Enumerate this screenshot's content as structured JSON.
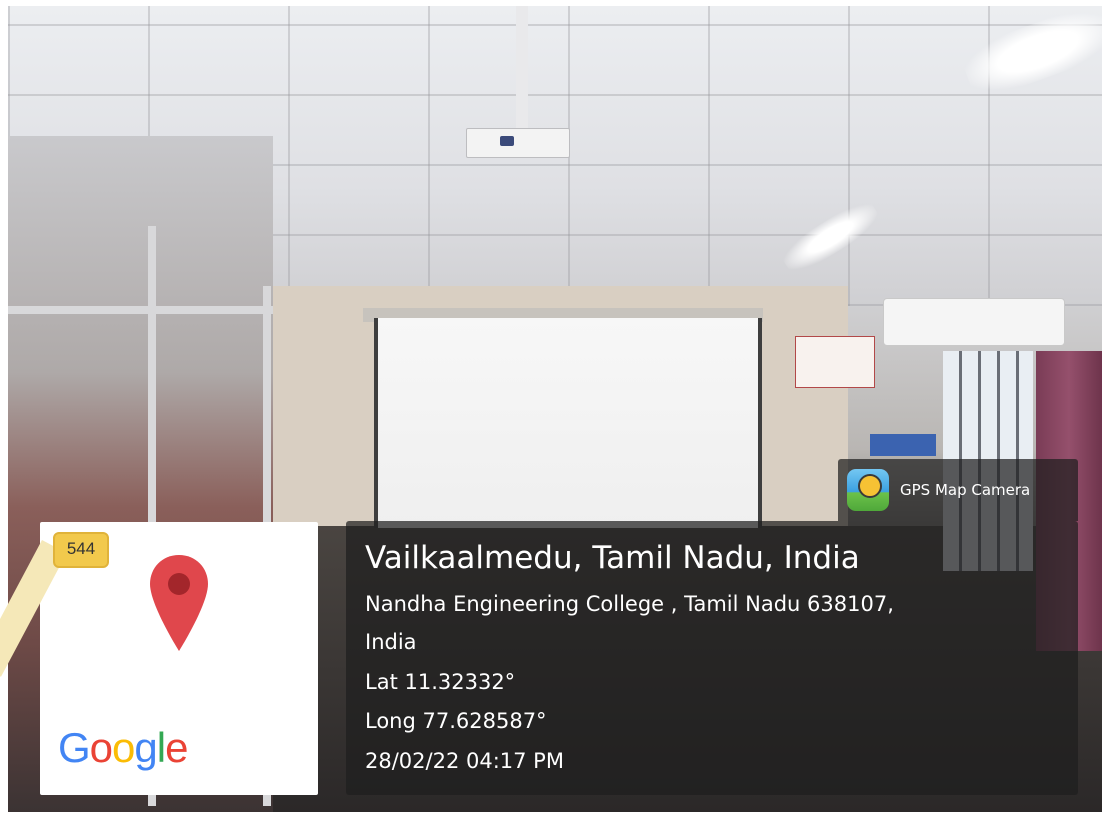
{
  "map": {
    "route_number": "544",
    "logo": "Google",
    "pin_icon": "map-pin-icon",
    "pin_color": "#e0474c"
  },
  "app": {
    "name": "GPS Map Camera",
    "icon": "gps-map-camera-icon"
  },
  "location": {
    "title": "Vailkaalmedu, Tamil Nadu, India",
    "address_line1": "Nandha Engineering College , Tamil Nadu 638107,",
    "address_line2": "India",
    "latitude": "Lat 11.32332°",
    "longitude": "Long 77.628587°",
    "timestamp": "28/02/22 04:17 PM"
  },
  "colors": {
    "panel_bg": "rgba(30,30,30,0.72)",
    "text": "#ffffff",
    "route_badge": "#f2c94c"
  }
}
